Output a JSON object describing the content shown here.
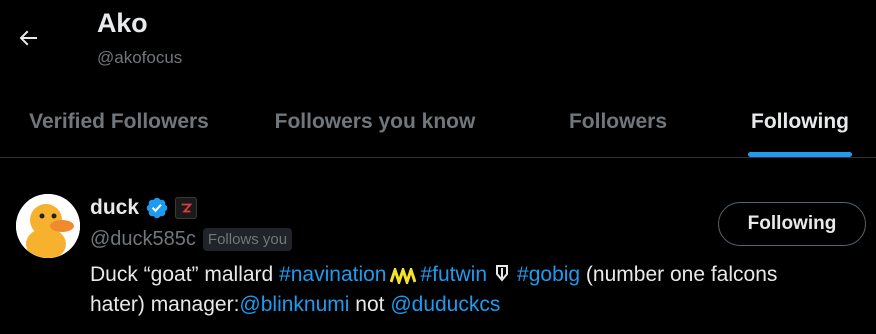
{
  "header": {
    "title": "Ako",
    "handle": "@akofocus"
  },
  "tabs": [
    {
      "label": "Verified Followers",
      "active": false
    },
    {
      "label": "Followers you know",
      "active": false
    },
    {
      "label": "Followers",
      "active": false
    },
    {
      "label": "Following",
      "active": true
    }
  ],
  "user": {
    "name": "duck",
    "handle": "@duck585c",
    "follows_you": "Follows you",
    "follow_button": "Following",
    "bio": {
      "part1": "Duck “goat” mallard ",
      "tag1": "#navination",
      "tag2": "#futwin",
      "tag3": "#gobig",
      "part2": " (number one falcons hater) manager:",
      "mention1": "@blinknumi",
      "part3": " not ",
      "mention2": "@duduckcs"
    }
  },
  "colors": {
    "background": "#000000",
    "accent": "#1d9bf0",
    "muted": "#71767b",
    "text": "#e7e9ea"
  }
}
